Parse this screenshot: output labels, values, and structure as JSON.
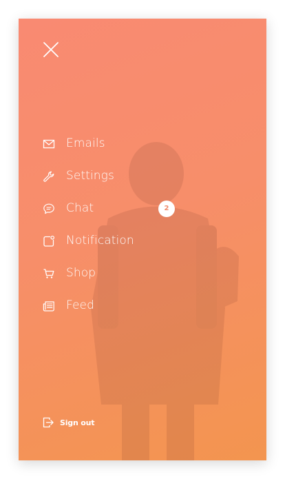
{
  "drawer": {
    "close_icon": "close-icon",
    "menu": [
      {
        "label": "Emails",
        "icon": "mail-icon"
      },
      {
        "label": "Settings",
        "icon": "wrench-icon"
      },
      {
        "label": "Chat",
        "icon": "chat-bubble-icon",
        "badge": "2"
      },
      {
        "label": "Notification",
        "icon": "notification-icon"
      },
      {
        "label": "Shop",
        "icon": "cart-icon"
      },
      {
        "label": "Feed",
        "icon": "newspaper-icon"
      }
    ],
    "signout": {
      "label": "Sign out",
      "icon": "sign-out-icon"
    }
  },
  "colors": {
    "gradient_top": "#f98a72",
    "gradient_bottom": "#f3954f",
    "text": "#ffffff",
    "badge_bg": "#ffffff",
    "badge_text": "#f08a6a"
  }
}
